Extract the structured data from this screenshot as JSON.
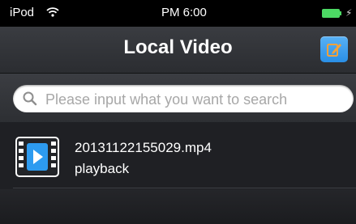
{
  "status_bar": {
    "carrier": "iPod",
    "time": "PM 6:00",
    "wifi_icon": "wifi-icon",
    "battery_icon": "battery-icon",
    "battery_level": 1.0,
    "battery_color": "#4cd964"
  },
  "nav": {
    "title": "Local Video",
    "edit_icon": "edit-icon",
    "accent": "#2a8fe6"
  },
  "search": {
    "placeholder": "Please input what you want to search",
    "value": "",
    "icon": "search-icon"
  },
  "videos": [
    {
      "name": "20131122155029.mp4",
      "status": "playback",
      "icon": "video-file-icon",
      "icon_color": "#2d9bf0"
    }
  ]
}
